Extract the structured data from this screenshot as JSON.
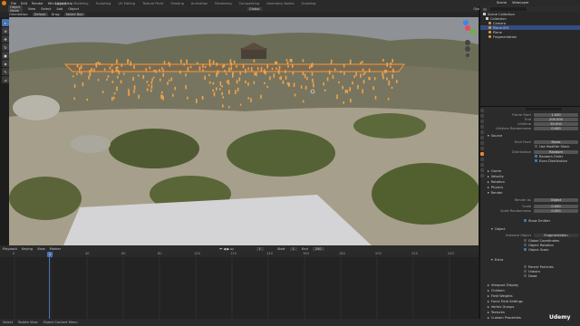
{
  "menubar": {
    "items": [
      "File",
      "Edit",
      "Render",
      "Window",
      "Help"
    ]
  },
  "workspaces": [
    "Layout",
    "Modeling",
    "Sculpting",
    "UV Editing",
    "Texture Paint",
    "Shading",
    "Animation",
    "Rendering",
    "Compositing",
    "Geometry Nodes",
    "Scripting"
  ],
  "active_workspace": "Layout",
  "scene": {
    "scene_name": "Scene",
    "view_layer": "ViewLayer"
  },
  "viewport_header": {
    "mode": "Object Mode",
    "menus": [
      "View",
      "Select",
      "Add",
      "Object"
    ],
    "transform": "Global",
    "options": "Options"
  },
  "viewport_header2": {
    "items": [
      "Orientation:",
      "Default",
      "Drag:",
      "Select Box"
    ]
  },
  "outliner": {
    "title": "Scene Collection",
    "rows": [
      {
        "label": "Scene Collection",
        "selected": false
      },
      {
        "label": "Collection",
        "selected": false
      },
      {
        "label": "Camera",
        "selected": false
      },
      {
        "label": "Plane.001",
        "selected": true
      },
      {
        "label": "Plane",
        "selected": false
      },
      {
        "label": "Fragmentation",
        "selected": false
      }
    ]
  },
  "props": {
    "rows": [
      {
        "label": "Frame Start",
        "value": "1.000"
      },
      {
        "label": "End",
        "value": "200.000"
      },
      {
        "label": "Lifetime",
        "value": "50.000"
      },
      {
        "label": "Lifetime Randomness",
        "value": "0.000"
      }
    ],
    "source": "Source",
    "emit_from": {
      "label": "Emit From",
      "value": "Faces"
    },
    "use_modifier_stack": "Use Modifier Stack",
    "distribution": {
      "label": "Distribution",
      "value": "Random"
    },
    "random_order": "Random Order",
    "even_distribution": "Even Distribution",
    "sections": [
      "Cache",
      "Velocity",
      "Rotation",
      "Physics",
      "Render"
    ],
    "render_as": {
      "label": "Render As",
      "value": "Object"
    },
    "scale": {
      "label": "Scale",
      "value": "0.050"
    },
    "scale_randomness": {
      "label": "Scale Randomness",
      "value": "0.000"
    },
    "show_emitter": "Show Emitter",
    "object_section": "Object",
    "instance_object": {
      "label": "Instance Object",
      "value": "Fragmentation"
    },
    "global_coordinates": "Global Coordinates",
    "object_rotation": "Object Rotation",
    "object_scale": "Object Scale",
    "extra_section": "Extra",
    "parent_particles": "Parent Particles",
    "unborn": "Unborn",
    "dead": "Dead",
    "more_sections": [
      "Viewport Display",
      "Children",
      "Field Weights",
      "Force Field Settings",
      "Vertex Groups",
      "Textures",
      "Custom Properties"
    ]
  },
  "timeline": {
    "menus": [
      "Playback",
      "Keying",
      "View",
      "Marker"
    ],
    "current_frame": "1",
    "start": "1",
    "end": "250",
    "start_label": "Start",
    "end_label": "End",
    "ticks": [
      "0",
      "20",
      "40",
      "60",
      "80",
      "100",
      "120",
      "140",
      "160",
      "180",
      "200",
      "220",
      "240"
    ]
  },
  "status": {
    "items": [
      "Select",
      "Rotate View",
      "Object Context Menu"
    ]
  },
  "watermark": "Udemy",
  "colors": {
    "accent": "#e87d0d",
    "selection": "#4772b3",
    "particles": "#f0a24a"
  }
}
